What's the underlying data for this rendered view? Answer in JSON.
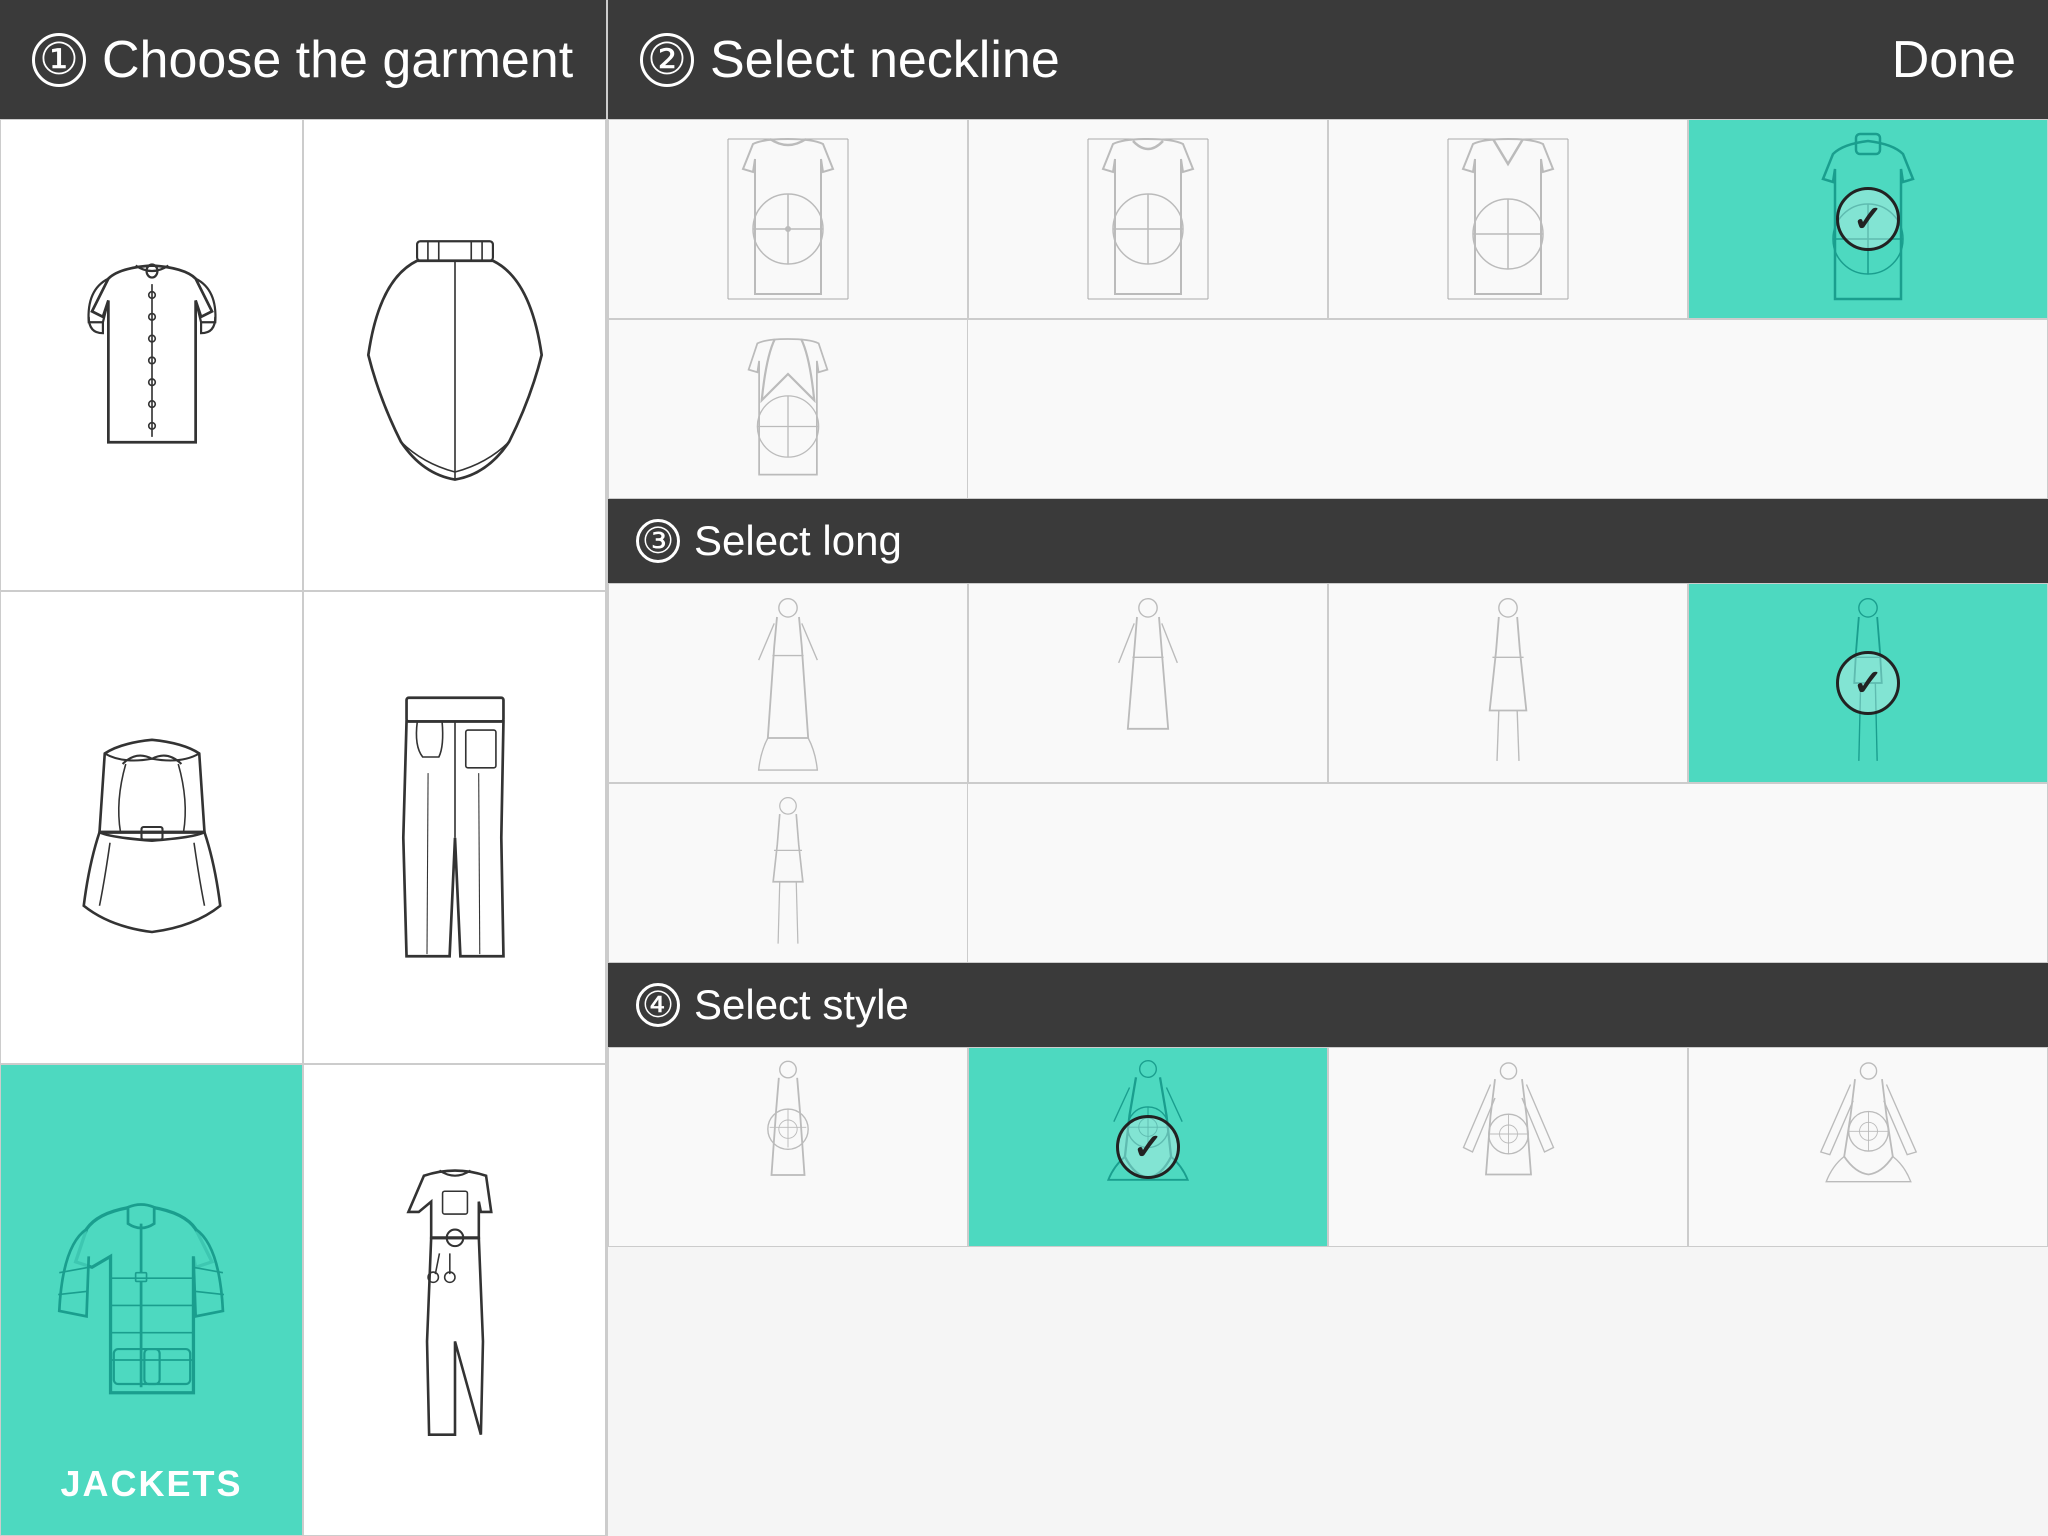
{
  "left_panel": {
    "header": {
      "step": "①",
      "title": "Choose the garment"
    },
    "garments": [
      {
        "id": "blouse",
        "label": "BLOUSE",
        "selected": false
      },
      {
        "id": "cape",
        "label": "CAPE",
        "selected": false
      },
      {
        "id": "bustier",
        "label": "BUSTIER",
        "selected": false
      },
      {
        "id": "pants",
        "label": "PANTS",
        "selected": false
      },
      {
        "id": "jacket",
        "label": "JACKETS",
        "selected": true
      },
      {
        "id": "jumpsuit",
        "label": "JUMPSUIT",
        "selected": false
      }
    ]
  },
  "right_panel": {
    "header": {
      "step": "②",
      "title": "Select neckline",
      "done_label": "Done"
    },
    "sections": [
      {
        "id": "neckline",
        "step": "②",
        "title": "Select neckline",
        "options": [
          {
            "id": "crew",
            "selected": false
          },
          {
            "id": "round",
            "selected": false
          },
          {
            "id": "v-neck",
            "selected": false
          },
          {
            "id": "cowl",
            "selected": true
          }
        ],
        "extra_options": [
          {
            "id": "deep-v",
            "selected": false
          }
        ]
      },
      {
        "id": "length",
        "step": "③",
        "title": "Select long",
        "options": [
          {
            "id": "long-dress",
            "selected": false
          },
          {
            "id": "midi-dress",
            "selected": false
          },
          {
            "id": "short-dress",
            "selected": false
          },
          {
            "id": "top",
            "selected": true
          }
        ],
        "extra_options": [
          {
            "id": "mini-dress",
            "selected": false
          }
        ]
      },
      {
        "id": "style",
        "step": "④",
        "title": "Select style",
        "options": [
          {
            "id": "style-a",
            "selected": false
          },
          {
            "id": "style-b",
            "selected": true
          },
          {
            "id": "style-c",
            "selected": false
          },
          {
            "id": "style-d",
            "selected": false
          }
        ]
      }
    ]
  }
}
